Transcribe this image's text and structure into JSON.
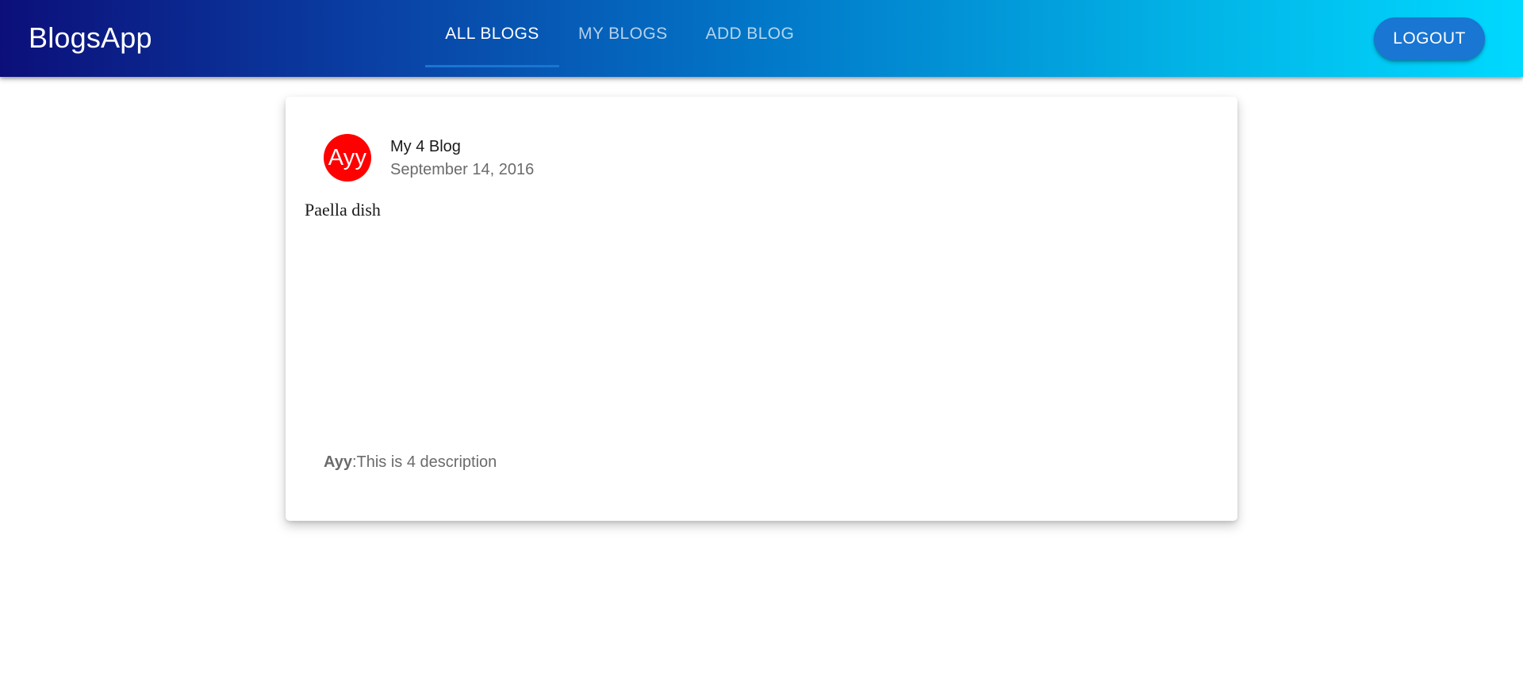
{
  "app": {
    "brand": "BlogsApp"
  },
  "nav": {
    "tabs": [
      {
        "label": "ALL BLOGS",
        "active": true
      },
      {
        "label": "MY BLOGS",
        "active": false
      },
      {
        "label": "ADD BLOG",
        "active": false
      }
    ],
    "logout_label": "LOGOUT"
  },
  "colors": {
    "gradient_start": "#0c0f7a",
    "gradient_end": "#00d9ff",
    "accent": "#1976d2",
    "avatar": "#ff0000"
  },
  "blog": {
    "avatar_text": "Ayy",
    "title": "My 4 Blog",
    "date": "September 14, 2016",
    "image_alt": "Paella dish",
    "author": "Ayy",
    "separator": ":",
    "description": "This is 4 description"
  }
}
